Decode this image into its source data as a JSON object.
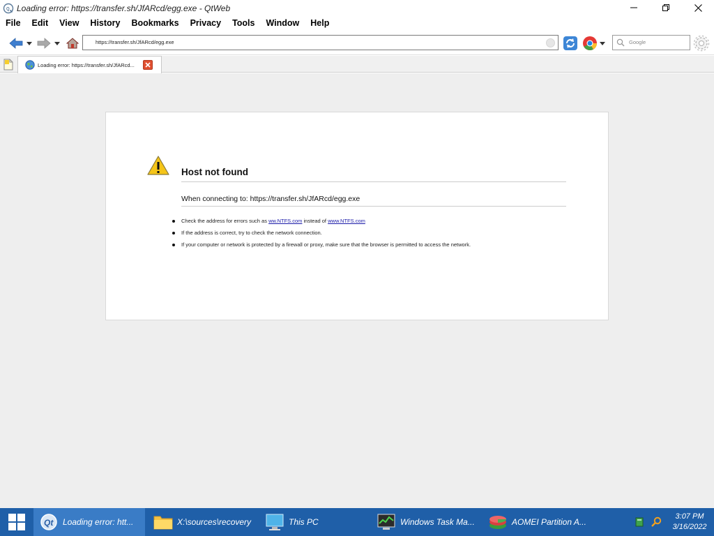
{
  "window": {
    "title": "Loading error: https://transfer.sh/JfARcd/egg.exe - QtWeb"
  },
  "menu": [
    "File",
    "Edit",
    "View",
    "History",
    "Bookmarks",
    "Privacy",
    "Tools",
    "Window",
    "Help"
  ],
  "toolbar": {
    "url": "https://transfer.sh/JfARcd/egg.exe",
    "search_placeholder": "Google"
  },
  "tab": {
    "title": "Loading error: https://transfer.sh/JfARcd..."
  },
  "error": {
    "title": "Host not found",
    "message": "When connecting to: https://transfer.sh/JfARcd/egg.exe",
    "tip1_pre": "Check the address for errors such as ",
    "tip1_link1": "ww.NTFS.com",
    "tip1_mid": " instead of ",
    "tip1_link2": "www.NTFS.com",
    "tip2": "If the address is correct, try to check the network connection.",
    "tip3": "If your computer or network is protected by a firewall or proxy, make sure that the browser is permitted to access the network."
  },
  "taskbar": {
    "items": [
      {
        "label": "Loading error: htt...",
        "icon": "qtweb-icon"
      },
      {
        "label": "X:\\sources\\recovery",
        "icon": "folder-icon"
      },
      {
        "label": "This PC",
        "icon": "computer-icon"
      },
      {
        "label": "Windows Task Ma...",
        "icon": "task-manager-icon"
      },
      {
        "label": "AOMEI Partition A...",
        "icon": "aomei-icon"
      }
    ],
    "time": "3:07 PM",
    "date": "3/16/2022"
  },
  "colors": {
    "taskbar": "#1f5fa8",
    "link": "#1a1aa8",
    "close_tab": "#e04f30"
  }
}
